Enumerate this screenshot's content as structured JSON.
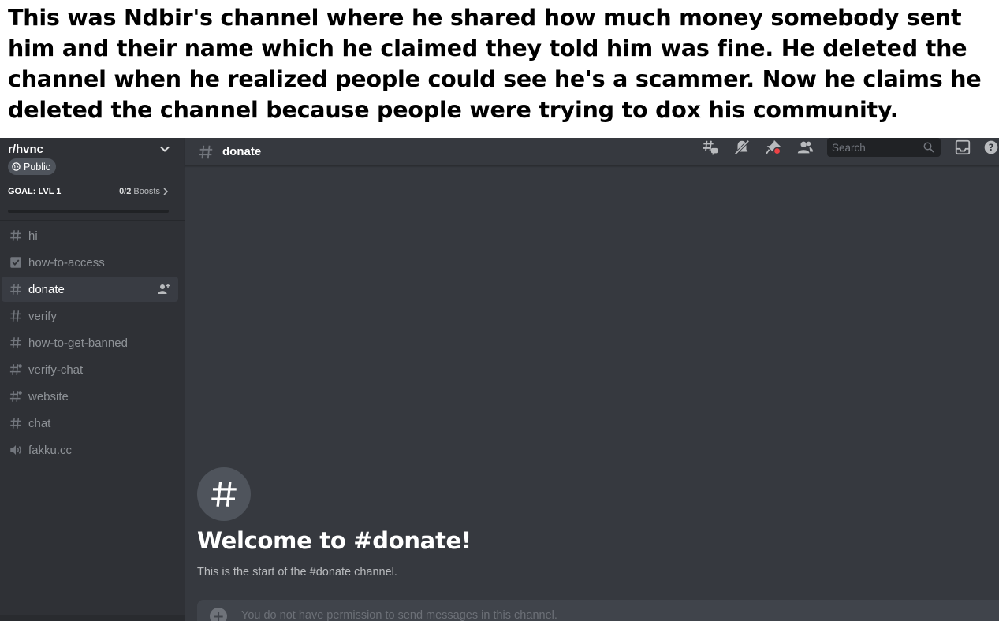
{
  "caption": {
    "text": "This was Ndbir's channel where he shared how much money somebody sent him and their name which he claimed they told him was fine. He deleted the channel when he realized people could see he's a scammer. Now he claims he deleted the channel because people were trying to dox his community."
  },
  "server": {
    "name": "r/hvnc",
    "public_label": "Public",
    "goal_label": "GOAL: LVL 1",
    "boost_count": "0/2",
    "boost_label": "Boosts",
    "boost_progress": 0
  },
  "channels": [
    {
      "name": "hi",
      "icon": "hash-icon",
      "active": false
    },
    {
      "name": "how-to-access",
      "icon": "rules-checkbox-icon",
      "active": false
    },
    {
      "name": "donate",
      "icon": "hash-icon",
      "active": true
    },
    {
      "name": "verify",
      "icon": "hash-icon",
      "active": false
    },
    {
      "name": "how-to-get-banned",
      "icon": "hash-icon",
      "active": false
    },
    {
      "name": "verify-chat",
      "icon": "hash-thread-icon",
      "active": false
    },
    {
      "name": "website",
      "icon": "hash-thread-icon",
      "active": false
    },
    {
      "name": "chat",
      "icon": "hash-icon",
      "active": false
    },
    {
      "name": "fakku.cc",
      "icon": "speaker-icon",
      "active": false
    }
  ],
  "header": {
    "channel_name": "donate",
    "search_placeholder": "Search"
  },
  "welcome": {
    "title": "Welcome to #donate!",
    "subtitle": "This is the start of the #donate channel."
  },
  "composer": {
    "placeholder": "You do not have permission to send messages in this channel."
  },
  "colors": {
    "sidebar": "#2f3136",
    "main": "#36393f",
    "active_channel": "#393c43",
    "muted_text": "#8e9297",
    "notification": "#ed4245"
  }
}
